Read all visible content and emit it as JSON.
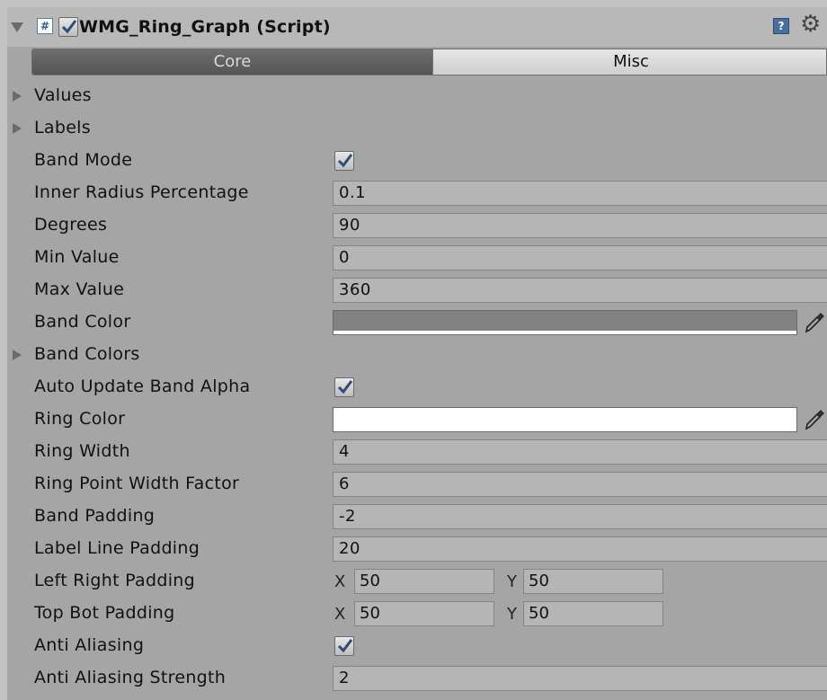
{
  "header": {
    "title": "WMG_Ring_Graph (Script)",
    "enabled": true
  },
  "tabs": [
    "Core",
    "Misc"
  ],
  "active_tab": "Core",
  "foldouts": {
    "values": "Values",
    "labels": "Labels",
    "band_colors": "Band Colors"
  },
  "fields": {
    "band_mode": {
      "label": "Band Mode",
      "checked": true
    },
    "inner_radius": {
      "label": "Inner Radius Percentage",
      "value": "0.1"
    },
    "degrees": {
      "label": "Degrees",
      "value": "90"
    },
    "min_value": {
      "label": "Min Value",
      "value": "0"
    },
    "max_value": {
      "label": "Max Value",
      "value": "360"
    },
    "band_color": {
      "label": "Band Color",
      "color": "#828282"
    },
    "auto_update_band_alpha": {
      "label": "Auto Update Band Alpha",
      "checked": true
    },
    "ring_color": {
      "label": "Ring Color",
      "color": "#ffffff"
    },
    "ring_width": {
      "label": "Ring Width",
      "value": "4"
    },
    "ring_point_width_factor": {
      "label": "Ring Point Width Factor",
      "value": "6"
    },
    "band_padding": {
      "label": "Band Padding",
      "value": "-2"
    },
    "label_line_padding": {
      "label": "Label Line Padding",
      "value": "20"
    },
    "left_right_padding": {
      "label": "Left Right Padding",
      "x_label": "X",
      "x": "50",
      "y_label": "Y",
      "y": "50"
    },
    "top_bot_padding": {
      "label": "Top Bot Padding",
      "x_label": "X",
      "x": "50",
      "y_label": "Y",
      "y": "50"
    },
    "anti_aliasing": {
      "label": "Anti Aliasing",
      "checked": true
    },
    "anti_aliasing_strength": {
      "label": "Anti Aliasing Strength",
      "value": "2"
    }
  },
  "icons": {
    "script": "script-icon",
    "help": "help-icon",
    "settings": "gear-icon",
    "picker": "eyedropper-icon"
  }
}
